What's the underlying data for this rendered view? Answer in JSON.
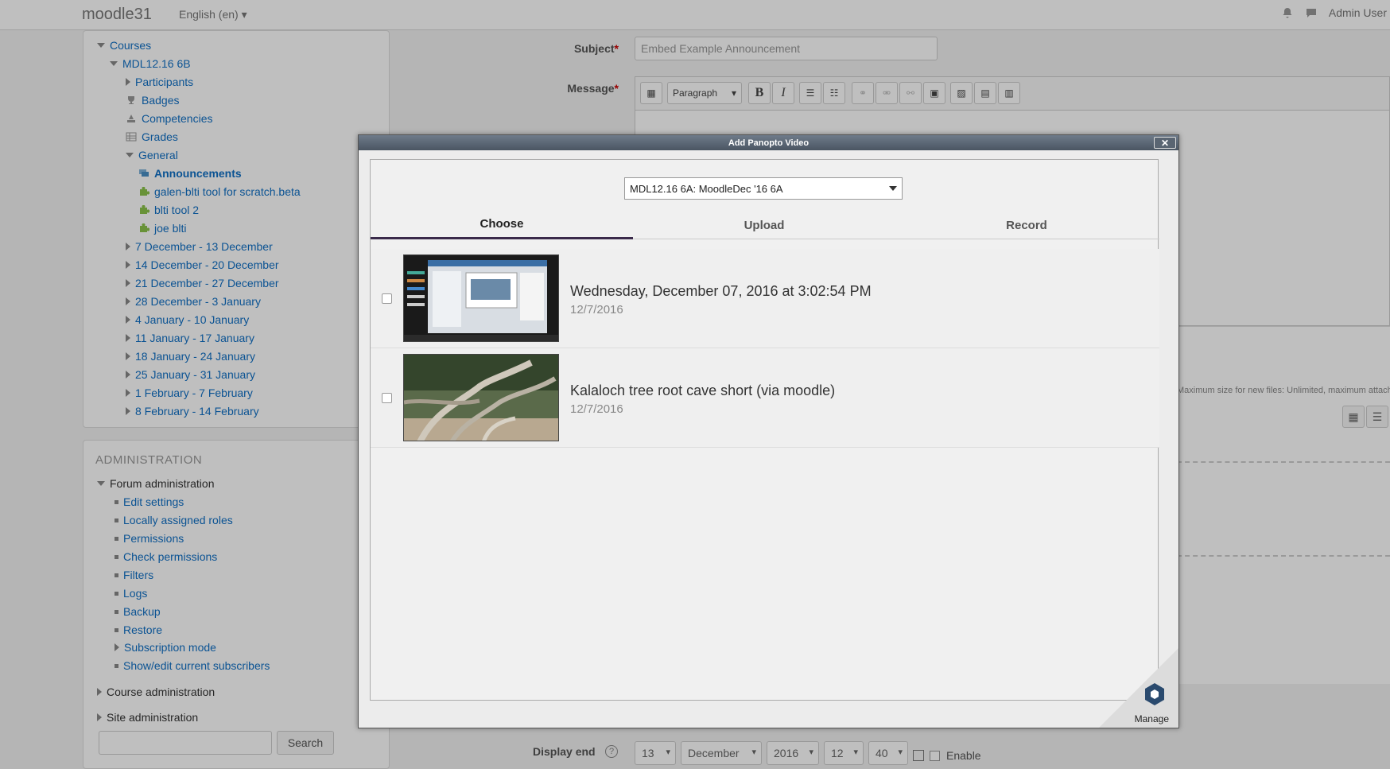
{
  "navbar": {
    "brand": "moodle31",
    "language": "English (en) ▾",
    "user": "Admin User"
  },
  "nav_tree": {
    "items": [
      {
        "label": "Courses",
        "icon": "triangle-down"
      },
      {
        "label": "MDL12.16 6B",
        "icon": "triangle-down"
      },
      {
        "label": "Participants",
        "icon": "triangle-right"
      },
      {
        "label": "Badges",
        "icon": "trophy"
      },
      {
        "label": "Competencies",
        "icon": "competency"
      },
      {
        "label": "Grades",
        "icon": "grid"
      },
      {
        "label": "General",
        "icon": "triangle-down"
      },
      {
        "label": "Announcements",
        "icon": "forum"
      },
      {
        "label": "galen-blti tool for scratch.beta",
        "icon": "puzzle"
      },
      {
        "label": "blti tool 2",
        "icon": "puzzle"
      },
      {
        "label": "joe blti",
        "icon": "puzzle"
      },
      {
        "label": "7 December - 13 December",
        "icon": "triangle-right"
      },
      {
        "label": "14 December - 20 December",
        "icon": "triangle-right"
      },
      {
        "label": "21 December - 27 December",
        "icon": "triangle-right"
      },
      {
        "label": "28 December - 3 January",
        "icon": "triangle-right"
      },
      {
        "label": "4 January - 10 January",
        "icon": "triangle-right"
      },
      {
        "label": "11 January - 17 January",
        "icon": "triangle-right"
      },
      {
        "label": "18 January - 24 January",
        "icon": "triangle-right"
      },
      {
        "label": "25 January - 31 January",
        "icon": "triangle-right"
      },
      {
        "label": "1 February - 7 February",
        "icon": "triangle-right"
      },
      {
        "label": "8 February - 14 February",
        "icon": "triangle-right"
      }
    ]
  },
  "administration": {
    "title": "ADMINISTRATION",
    "forum_admin": "Forum administration",
    "items": [
      "Edit settings",
      "Locally assigned roles",
      "Permissions",
      "Check permissions",
      "Filters",
      "Logs",
      "Backup",
      "Restore"
    ],
    "subscription_mode": "Subscription mode",
    "show_subscribers": "Show/edit current subscribers",
    "course_admin": "Course administration",
    "site_admin": "Site administration",
    "search_button": "Search"
  },
  "form": {
    "subject_label": "Subject",
    "subject_placeholder": "Embed Example Announcement",
    "message_label": "Message",
    "required_mark": "*",
    "paragraph_label": "Paragraph",
    "file_hint": "Maximum size for new files: Unlimited, maximum attachments",
    "display_end_label": "Display end",
    "display_end": {
      "day": "13",
      "month": "December",
      "year": "2016",
      "hour": "12",
      "minute": "40"
    },
    "enable_label": "Enable"
  },
  "modal": {
    "title": "Add Panopto Video",
    "close": "✕",
    "folder": "MDL12.16 6A: MoodleDec '16 6A",
    "tabs": [
      "Choose",
      "Upload",
      "Record"
    ],
    "active_tab": "Choose",
    "sessions": [
      {
        "title": "Wednesday, December 07, 2016 at 3:02:54 PM",
        "date": "12/7/2016"
      },
      {
        "title": "Kalaloch tree root cave short (via moodle)",
        "date": "12/7/2016"
      }
    ],
    "manage_label": "Manage"
  },
  "colors": {
    "link": "#0f6fc5",
    "accent": "#3a2a4a",
    "panopto": "#2a4a6e"
  }
}
